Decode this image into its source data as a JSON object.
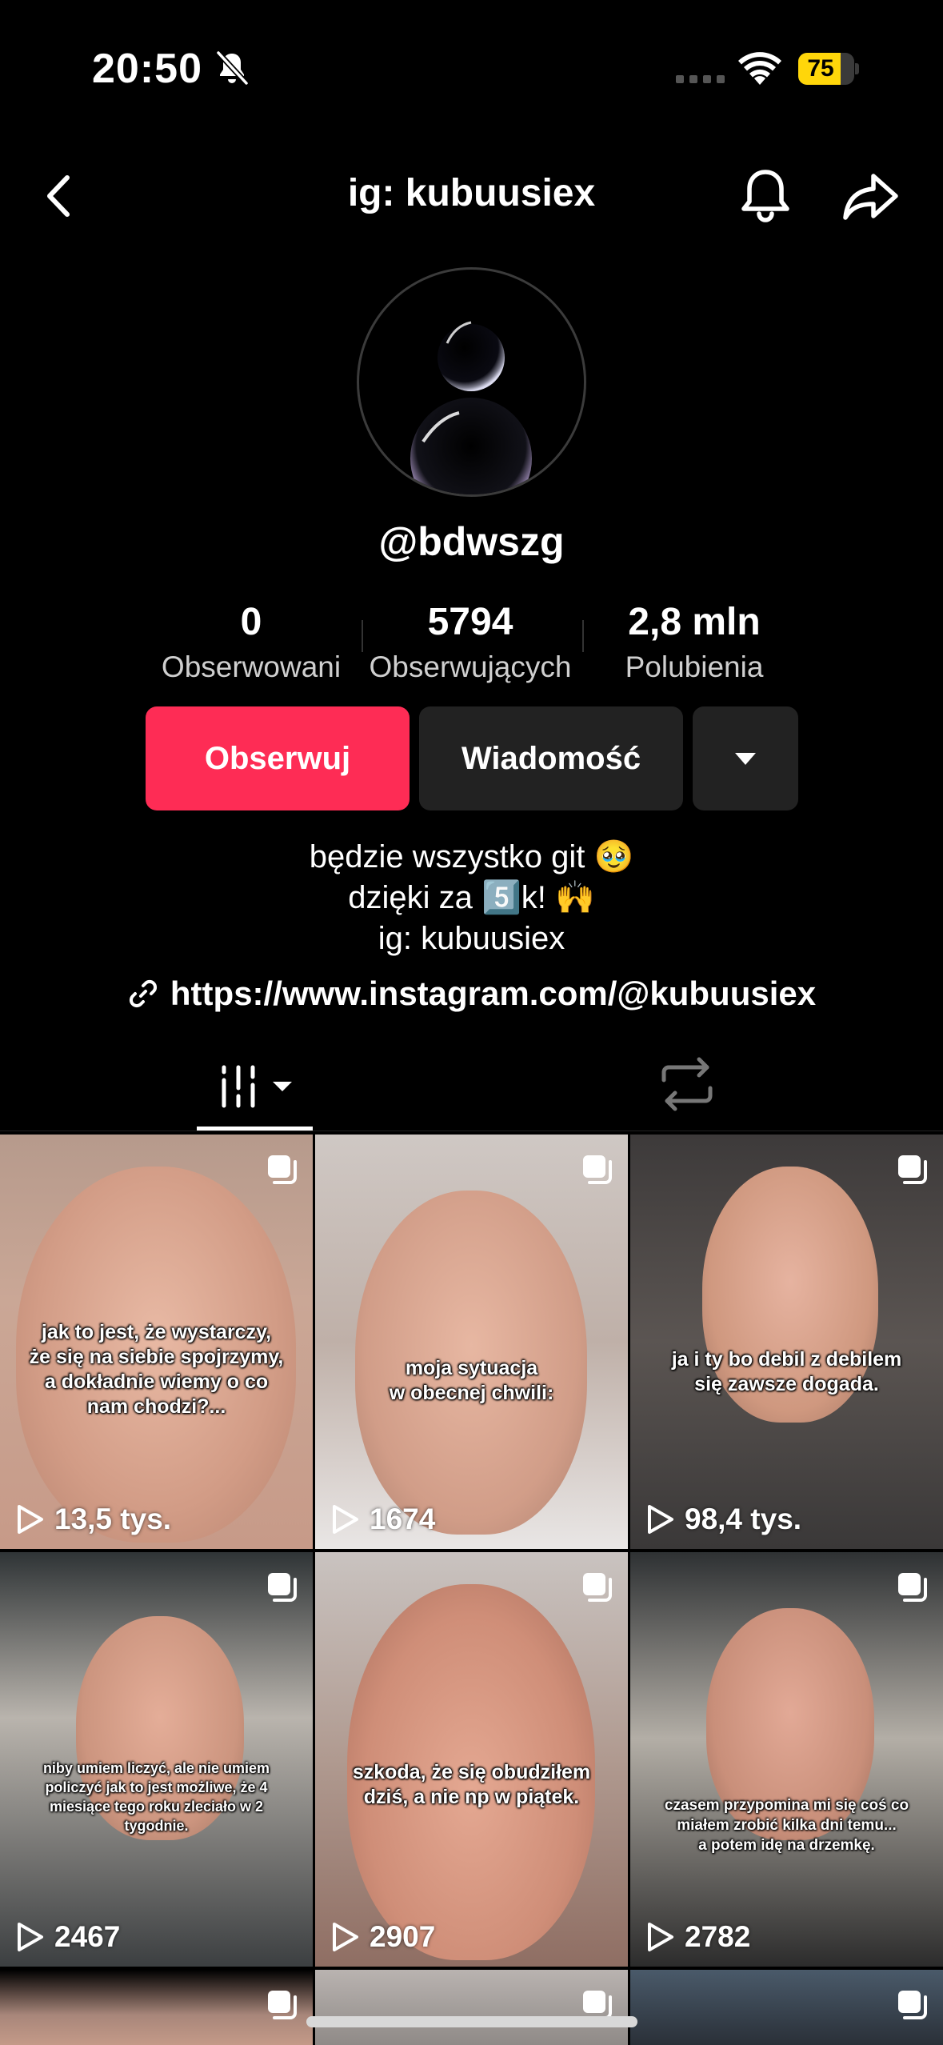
{
  "status_bar": {
    "time": "20:50",
    "battery_level": 75,
    "battery_label": "75",
    "battery_color": "#ffd60a"
  },
  "header": {
    "title": "ig: kubuusiex",
    "back_icon": "chevron-left-icon",
    "notify_icon": "bell-icon",
    "share_icon": "share-icon"
  },
  "profile": {
    "username": "@bdwszg",
    "stats": [
      {
        "value": "0",
        "label": "Obserwowani"
      },
      {
        "value": "5794",
        "label": "Obserwujących"
      },
      {
        "value": "2,8 mln",
        "label": "Polubienia"
      }
    ],
    "follow_label": "Obserwuj",
    "message_label": "Wiadomość",
    "accent_color": "#fe2c55",
    "bio": [
      "będzie wszystko git 🥹",
      "dzięki za 5️⃣k! 🙌",
      "ig: kubuusiex"
    ],
    "link": "https://www.instagram.com/@kubuusiex"
  },
  "tabs": {
    "videos_icon": "grid-columns-icon",
    "reposts_icon": "repost-icon"
  },
  "videos": [
    {
      "views": "13,5 tys.",
      "caption": "jak to jest, że wystarczy,\nże się na siebie spojrzymy,\na dokładnie wiemy o co\nnam chodzi?..."
    },
    {
      "views": "1674",
      "caption": "moja sytuacja\nw obecnej chwili:"
    },
    {
      "views": "98,4 tys.",
      "caption": "ja i ty bo debil z debilem\nsię zawsze dogada."
    },
    {
      "views": "2467",
      "caption": "niby umiem liczyć, ale nie umiem\npoliczyć jak to jest możliwe, że 4\nmiesiące tego roku zleciało w 2\ntygodnie."
    },
    {
      "views": "2907",
      "caption": "szkoda, że się obudziłem\ndziś, a nie np w piątek."
    },
    {
      "views": "2782",
      "caption": "czasem przypomina mi się coś co\nmiałem zrobić kilka dni temu...\na potem idę na drzemkę."
    }
  ]
}
